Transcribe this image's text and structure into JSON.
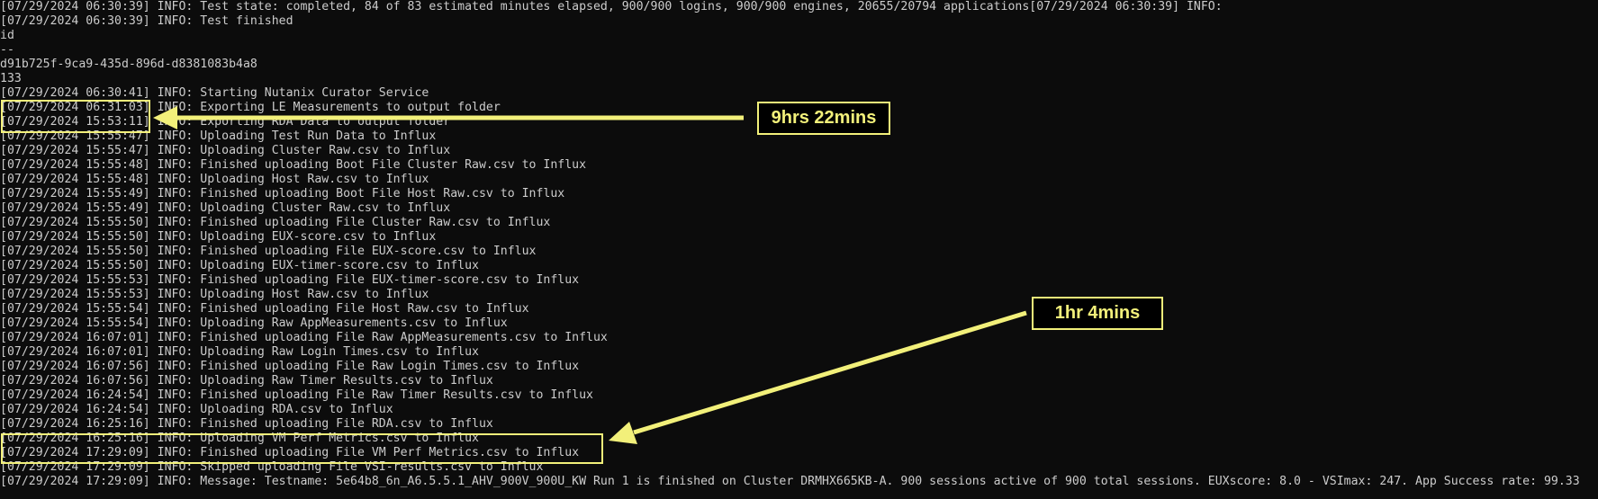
{
  "log": {
    "lines": [
      "[07/29/2024 06:30:39] INFO: Test state: completed, 84 of 83 estimated minutes elapsed, 900/900 logins, 900/900 engines, 20655/20794 applications[07/29/2024 06:30:39] INFO:",
      "[07/29/2024 06:30:39] INFO: Test finished",
      "id",
      "--",
      "d91b725f-9ca9-435d-896d-d8381083b4a8",
      "133",
      "[07/29/2024 06:30:41] INFO: Starting Nutanix Curator Service",
      "[07/29/2024 06:31:03] INFO: Exporting LE Measurements to output folder",
      "[07/29/2024 15:53:11] INFO: Exporting RDA Data to output folder",
      "[07/29/2024 15:55:47] INFO: Uploading Test Run Data to Influx",
      "[07/29/2024 15:55:47] INFO: Uploading Cluster Raw.csv to Influx",
      "[07/29/2024 15:55:48] INFO: Finished uploading Boot File Cluster Raw.csv to Influx",
      "[07/29/2024 15:55:48] INFO: Uploading Host Raw.csv to Influx",
      "[07/29/2024 15:55:49] INFO: Finished uploading Boot File Host Raw.csv to Influx",
      "[07/29/2024 15:55:49] INFO: Uploading Cluster Raw.csv to Influx",
      "[07/29/2024 15:55:50] INFO: Finished uploading File Cluster Raw.csv to Influx",
      "[07/29/2024 15:55:50] INFO: Uploading EUX-score.csv to Influx",
      "[07/29/2024 15:55:50] INFO: Finished uploading File EUX-score.csv to Influx",
      "[07/29/2024 15:55:50] INFO: Uploading EUX-timer-score.csv to Influx",
      "[07/29/2024 15:55:53] INFO: Finished uploading File EUX-timer-score.csv to Influx",
      "[07/29/2024 15:55:53] INFO: Uploading Host Raw.csv to Influx",
      "[07/29/2024 15:55:54] INFO: Finished uploading File Host Raw.csv to Influx",
      "[07/29/2024 15:55:54] INFO: Uploading Raw AppMeasurements.csv to Influx",
      "[07/29/2024 16:07:01] INFO: Finished uploading File Raw AppMeasurements.csv to Influx",
      "[07/29/2024 16:07:01] INFO: Uploading Raw Login Times.csv to Influx",
      "[07/29/2024 16:07:56] INFO: Finished uploading File Raw Login Times.csv to Influx",
      "[07/29/2024 16:07:56] INFO: Uploading Raw Timer Results.csv to Influx",
      "[07/29/2024 16:24:54] INFO: Finished uploading File Raw Timer Results.csv to Influx",
      "[07/29/2024 16:24:54] INFO: Uploading RDA.csv to Influx",
      "[07/29/2024 16:25:16] INFO: Finished uploading File RDA.csv to Influx",
      "[07/29/2024 16:25:16] INFO: Uploading VM Perf Metrics.csv to Influx",
      "[07/29/2024 17:29:09] INFO: Finished uploading File VM Perf Metrics.csv to Influx",
      "[07/29/2024 17:29:09] INFO: Skipped uploading File VSI-results.csv to Influx",
      "[07/29/2024 17:29:09] INFO: Message: Testname: 5e64b8_6n_A6.5.5.1_AHV_900V_900U_KW Run 1 is finished on Cluster DRMHX665KB-A. 900 sessions active of 900 total sessions. EUXscore: 8.0 - VSImax: 247. App Success rate: 99.33"
    ]
  },
  "annotations": {
    "callout_1": "9hrs 22mins",
    "callout_2": "1hr 4mins"
  },
  "colors": {
    "background": "#0c0c0c",
    "text": "#cccccc",
    "annotation": "#f2f07a"
  }
}
